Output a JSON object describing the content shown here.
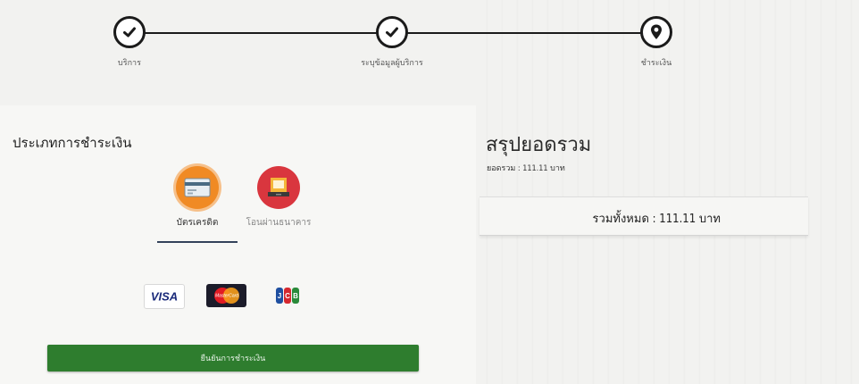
{
  "stepper": {
    "steps": [
      {
        "label": "บริการ",
        "status": "done",
        "icon": "check-icon"
      },
      {
        "label": "ระบุข้อมูลผู้บริการ",
        "status": "done",
        "icon": "check-icon"
      },
      {
        "label": "ชำระเงิน",
        "status": "current",
        "icon": "map-pin-icon"
      }
    ]
  },
  "payment": {
    "title": "ประเภทการชำระเงิน",
    "options": [
      {
        "label": "บัตรเครดิต",
        "icon": "credit-card-icon",
        "color": "#f08a24",
        "selected": true
      },
      {
        "label": "โอนผ่านธนาคาร",
        "icon": "bank-transfer-icon",
        "color": "#d9363e",
        "selected": false
      }
    ],
    "card_logos": [
      {
        "name": "VISA",
        "icon": "visa-logo"
      },
      {
        "name": "mastercard",
        "icon": "mastercard-logo"
      },
      {
        "name": "JCB",
        "icon": "jcb-logo"
      }
    ],
    "submit_label": "ยืนยันการชำระเงิน"
  },
  "summary": {
    "title": "สรุปยอดรวม",
    "subtotal_label": "ยอดรวม : 111.11 บาท",
    "total_label": "รวมทั้งหมด : 111.11 บาท"
  },
  "colors": {
    "primary_button": "#2e7d2e",
    "credit_card_icon_bg": "#f08a24",
    "bank_icon_bg": "#d9363e",
    "stepper": "#1b1b1b"
  }
}
